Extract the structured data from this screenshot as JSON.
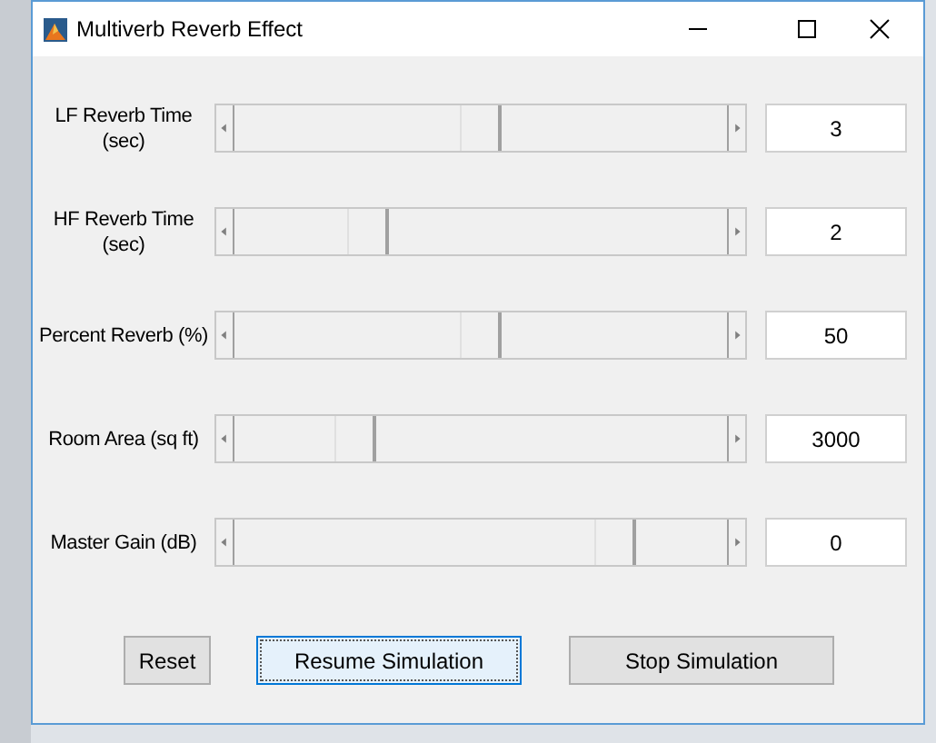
{
  "window": {
    "title": "Multiverb Reverb Effect"
  },
  "controls": [
    {
      "label": "LF Reverb Time (sec)",
      "level": 0.5,
      "value": "3"
    },
    {
      "label": "HF Reverb Time (sec)",
      "level": 0.25,
      "value": "2"
    },
    {
      "label": "Percent Reverb (%)",
      "level": 0.5,
      "value": "50"
    },
    {
      "label": "Room Area (sq ft)",
      "level": 0.22,
      "value": "3000"
    },
    {
      "label": "Master Gain (dB)",
      "level": 0.8,
      "value": "0"
    }
  ],
  "buttons": [
    {
      "label": "Reset",
      "focused": false
    },
    {
      "label": "Resume Simulation",
      "focused": true
    },
    {
      "label": "Stop Simulation",
      "focused": false
    }
  ]
}
